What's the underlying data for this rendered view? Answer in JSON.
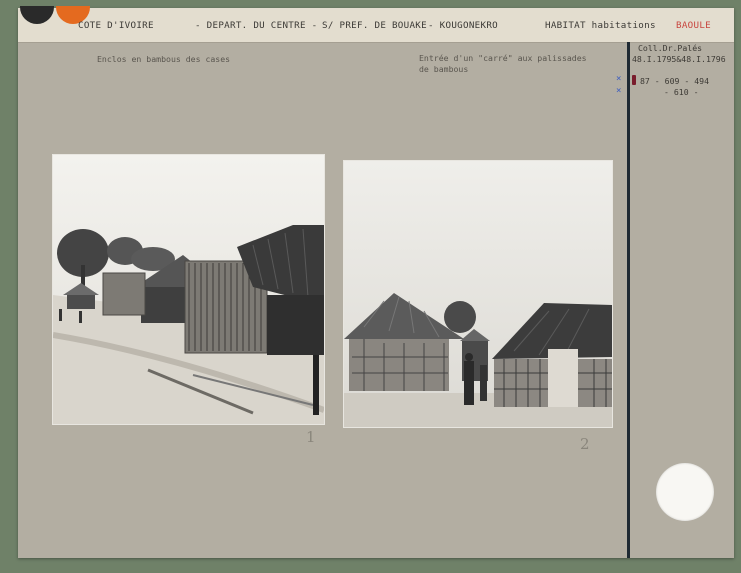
{
  "header": {
    "country": "COTE D'IVOIRE",
    "department": "- DEPART. DU CENTRE -",
    "subprefecture": "S/ PREF. DE BOUAKE",
    "village": "- KOUGONEKRO",
    "category": "HABITAT habitations",
    "people": "BAOULE"
  },
  "notes": {
    "left_caption": "Enclos en bambous des cases",
    "right_caption_line1": "Entrée d'un \"carré\" aux palissades",
    "right_caption_line2": "de bambous"
  },
  "reference": {
    "collection": "Coll.Dr.Palés",
    "inventory": "48.I.1795&48.I.1796",
    "numbers_line1": "87 - 609 - 494",
    "numbers_line2": "- 610 -"
  },
  "photo_labels": {
    "first": "1",
    "second": "2"
  },
  "colors": {
    "card": "#b3aea2",
    "header": "#e3ddcf",
    "accent_red": "#c8463f",
    "divider": "#1f2a33",
    "orange_dot": "#e46a1f"
  }
}
